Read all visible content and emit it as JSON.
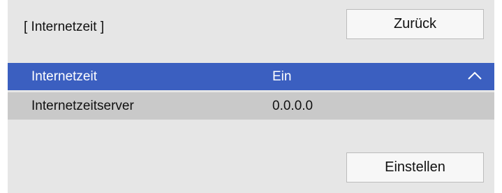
{
  "header": {
    "title": "[ Internetzeit ]"
  },
  "buttons": {
    "back_label": "Zurück",
    "set_label": "Einstellen"
  },
  "rows": [
    {
      "label": "Internetzeit",
      "value": "Ein",
      "selected": true,
      "icon": "chevron-up-icon"
    },
    {
      "label": "Internetzeitserver",
      "value": "0.0.0.0",
      "selected": false
    }
  ],
  "colors": {
    "selection": "#3b5fc0",
    "panel": "#e6e6e6",
    "row_alt": "#c9c9c9"
  }
}
